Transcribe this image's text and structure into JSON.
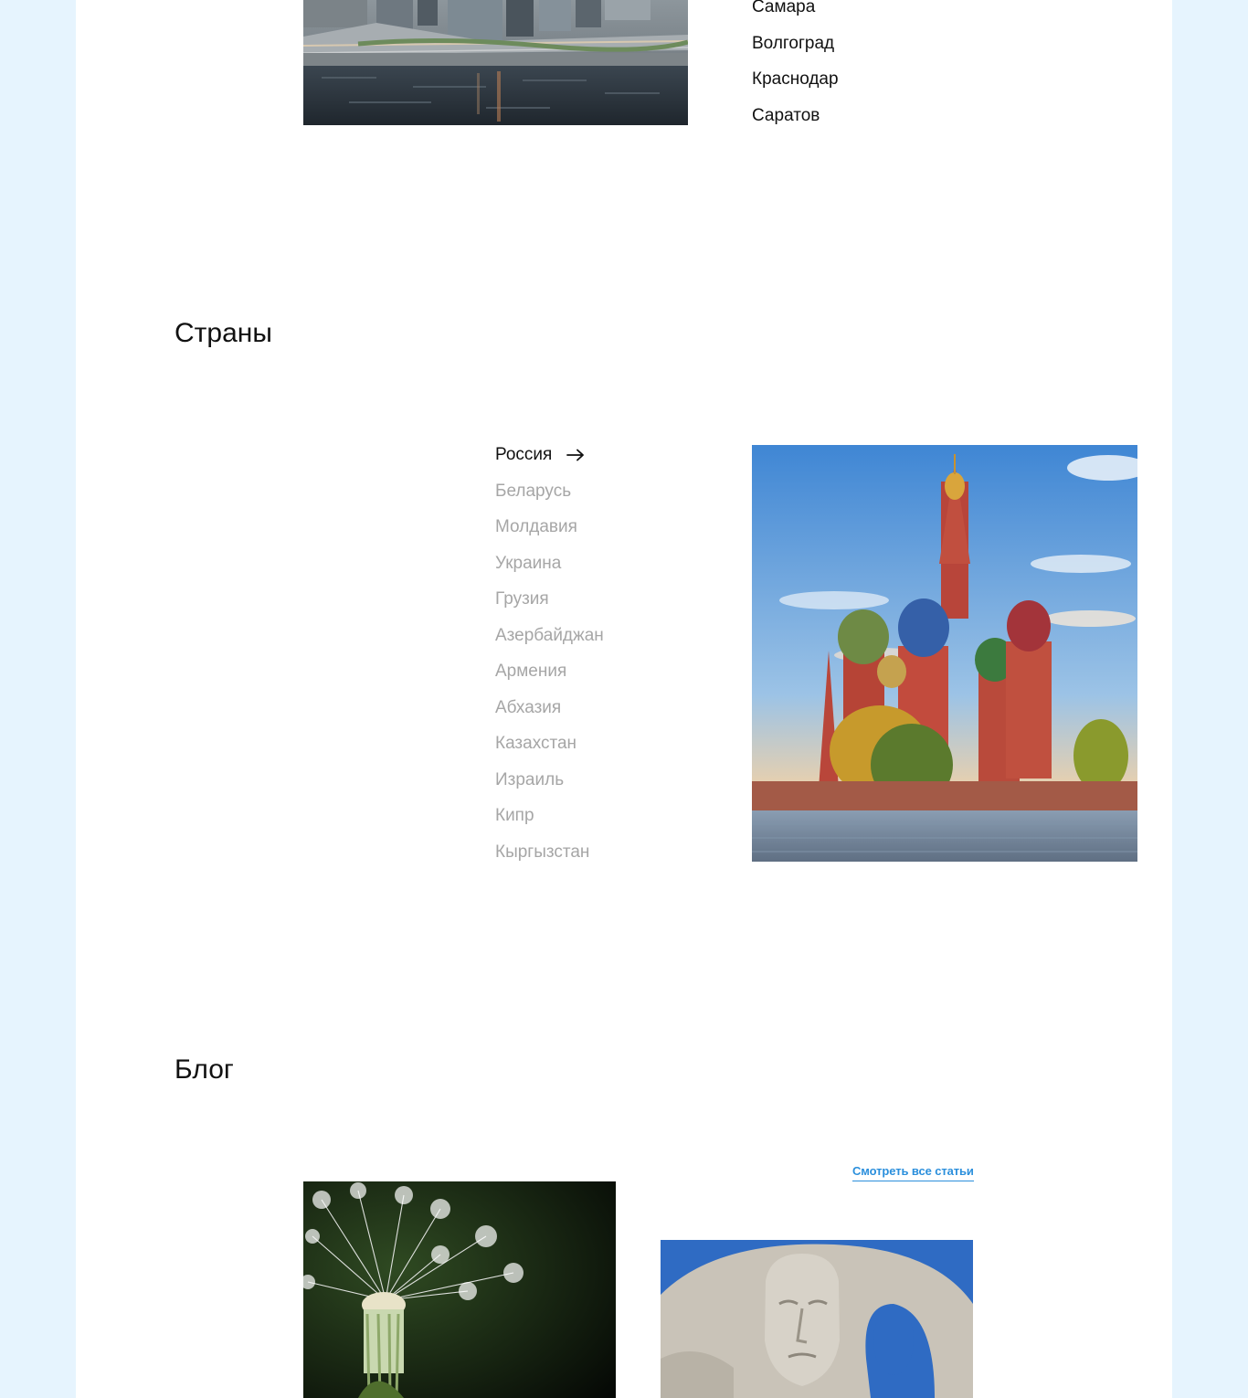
{
  "cities": {
    "items": [
      "Самара",
      "Волгоград",
      "Краснодар",
      "Саратов"
    ]
  },
  "countries": {
    "title": "Страны",
    "items": [
      {
        "label": "Россия",
        "active": true
      },
      {
        "label": "Беларусь"
      },
      {
        "label": "Молдавия"
      },
      {
        "label": "Украина"
      },
      {
        "label": "Грузия"
      },
      {
        "label": "Азербайджан"
      },
      {
        "label": "Армения"
      },
      {
        "label": "Абхазия"
      },
      {
        "label": "Казахстан"
      },
      {
        "label": "Израиль"
      },
      {
        "label": "Кипр"
      },
      {
        "label": "Кыргызстан"
      }
    ]
  },
  "blog": {
    "title": "Блог",
    "all_articles_label": "Смотреть все статьи"
  },
  "colors": {
    "background": "#e6f4fe",
    "accent_link": "#2b8fdc",
    "inactive_text": "#a6a6a6",
    "active_text": "#111111"
  },
  "icons": {
    "active_country": "arrow-right-icon"
  }
}
